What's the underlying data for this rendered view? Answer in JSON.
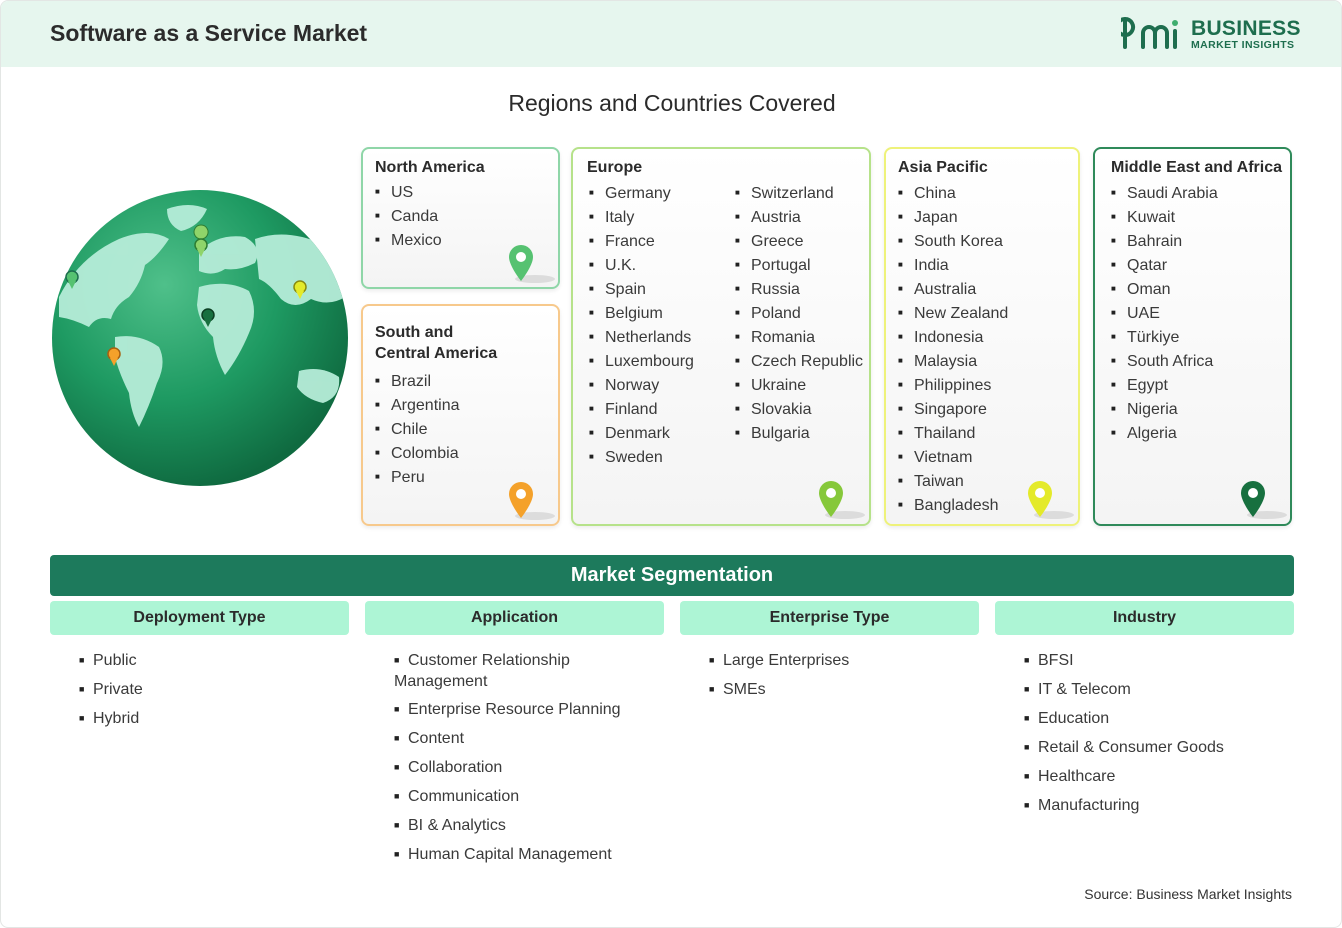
{
  "header": {
    "title": "Software as a Service Market",
    "logo_line1": "BUSINESS",
    "logo_line2": "MARKET INSIGHTS"
  },
  "regions": {
    "title": "Regions and Countries Covered",
    "north_america": {
      "title": "North America",
      "items": [
        "US",
        "Canda",
        "Mexico"
      ]
    },
    "south_america": {
      "title_line1": "South and",
      "title_line2": "Central America",
      "items": [
        "Brazil",
        "Argentina",
        "Chile",
        "Colombia",
        "Peru"
      ]
    },
    "europe": {
      "title": "Europe",
      "col1": [
        "Germany",
        "Italy",
        "France",
        "U.K.",
        "Spain",
        "Belgium",
        "Netherlands",
        "Luxembourg",
        "Norway",
        "Finland",
        "Denmark",
        "Sweden"
      ],
      "col2": [
        "Switzerland",
        "Austria",
        "Greece",
        "Portugal",
        "Russia",
        "Poland",
        "Romania",
        "Czech Republic",
        "Ukraine",
        "Slovakia",
        "Bulgaria"
      ]
    },
    "asia_pacific": {
      "title": "Asia Pacific",
      "items": [
        "China",
        "Japan",
        "South Korea",
        "India",
        "Australia",
        "New Zealand",
        "Indonesia",
        "Malaysia",
        "Philippines",
        "Singapore",
        "Thailand",
        "Vietnam",
        "Taiwan",
        "Bangladesh"
      ]
    },
    "mea": {
      "title": "Middle East and Africa",
      "items": [
        "Saudi Arabia",
        "Kuwait",
        "Bahrain",
        "Qatar",
        "Oman",
        "UAE",
        "Türkiye",
        "South Africa",
        "Egypt",
        "Nigeria",
        "Algeria"
      ]
    }
  },
  "segmentation": {
    "title": "Market Segmentation",
    "columns": [
      {
        "title": "Deployment Type",
        "items": [
          "Public",
          "Private",
          "Hybrid"
        ]
      },
      {
        "title": "Application",
        "items": [
          "Customer Relationship Management",
          "Enterprise Resource Planning",
          "Content",
          "Collaboration",
          "Communication",
          "BI & Analytics",
          "Human Capital Management"
        ]
      },
      {
        "title": "Enterprise Type",
        "items": [
          "Large Enterprises",
          "SMEs"
        ]
      },
      {
        "title": "Industry",
        "items": [
          "BFSI",
          "IT & Telecom",
          "Education",
          "Retail & Consumer Goods",
          "Healthcare",
          "Manufacturing"
        ]
      }
    ]
  },
  "source": "Source: Business Market Insights",
  "colors": {
    "header_bg": "#e6f6ee",
    "brand_green": "#1e6e4e",
    "seg_bar": "#1d7a5c",
    "seg_head": "#adf5d5",
    "north_america_border": "#8fd6a8",
    "south_america_border": "#f7c98c",
    "europe_border": "#b6e28a",
    "asia_pacific_border": "#eef27a",
    "mea_border": "#2f8a5a",
    "pin_green_light": "#56c271",
    "pin_orange": "#f4a12a",
    "pin_lime": "#86c83a",
    "pin_yellow": "#e4ea2a",
    "pin_dark_green": "#17703f"
  }
}
